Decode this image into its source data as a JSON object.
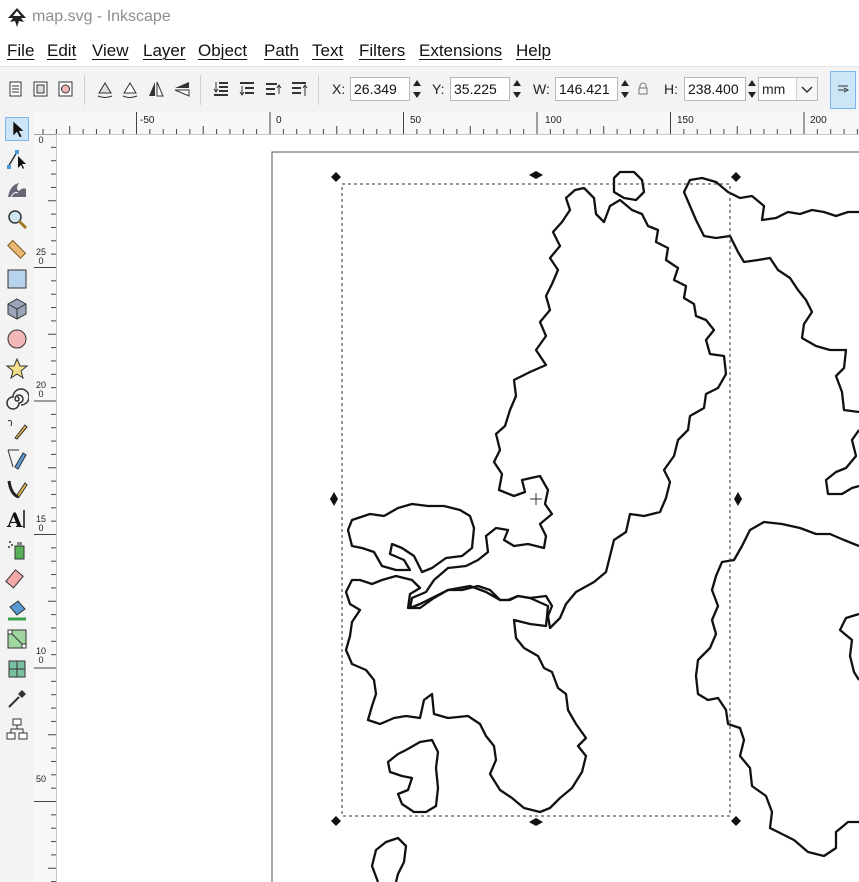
{
  "window": {
    "title": "map.svg - Inkscape"
  },
  "menu": {
    "file": "File",
    "edit": "Edit",
    "view": "View",
    "layer": "Layer",
    "object": "Object",
    "path": "Path",
    "text": "Text",
    "filters": "Filters",
    "extensions": "Extensions",
    "help": "Help"
  },
  "toolbar": {
    "x_label": "X:",
    "x_value": "26.349",
    "y_label": "Y:",
    "y_value": "35.225",
    "w_label": "W:",
    "w_value": "146.421",
    "h_label": "H:",
    "h_value": "238.400",
    "unit": "mm"
  },
  "ruler": {
    "h_labels": [
      "-50",
      "0",
      "50",
      "100",
      "150",
      "200"
    ],
    "v_labels": [
      "0",
      "250",
      "200",
      "150",
      "100",
      "50"
    ]
  },
  "colors": {
    "accent": "#cde6f7",
    "accent_border": "#7eb4ea",
    "ink": "#111111"
  }
}
